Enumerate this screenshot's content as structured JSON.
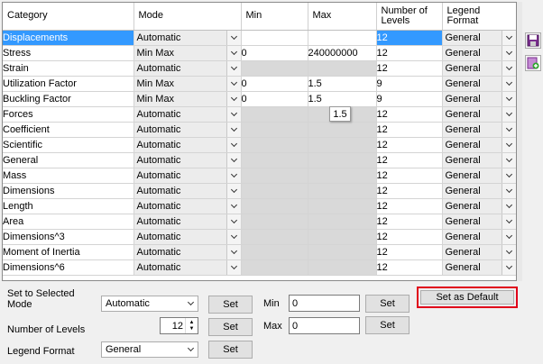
{
  "grid": {
    "headers": {
      "category": "Category",
      "mode": "Mode",
      "min": "Min",
      "max": "Max",
      "levels": "Number of Levels",
      "legend": "Legend Format"
    },
    "rows": [
      {
        "category": "Displacements",
        "mode": "Automatic",
        "min": "",
        "max": "",
        "levels": "12",
        "legend": "General"
      },
      {
        "category": "Stress",
        "mode": "Min Max",
        "min": "0",
        "max": "240000000",
        "levels": "12",
        "legend": "General"
      },
      {
        "category": "Strain",
        "mode": "Automatic",
        "min": "",
        "max": "",
        "levels": "12",
        "legend": "General"
      },
      {
        "category": "Utilization Factor",
        "mode": "Min Max",
        "min": "0",
        "max": "1.5",
        "levels": "9",
        "legend": "General"
      },
      {
        "category": "Buckling Factor",
        "mode": "Min Max",
        "min": "0",
        "max": "1.5",
        "levels": "9",
        "legend": "General"
      },
      {
        "category": "Forces",
        "mode": "Automatic",
        "min": "",
        "max": "",
        "levels": "12",
        "legend": "General"
      },
      {
        "category": "Coefficient",
        "mode": "Automatic",
        "min": "",
        "max": "",
        "levels": "12",
        "legend": "General"
      },
      {
        "category": "Scientific",
        "mode": "Automatic",
        "min": "",
        "max": "",
        "levels": "12",
        "legend": "General"
      },
      {
        "category": "General",
        "mode": "Automatic",
        "min": "",
        "max": "",
        "levels": "12",
        "legend": "General"
      },
      {
        "category": "Mass",
        "mode": "Automatic",
        "min": "",
        "max": "",
        "levels": "12",
        "legend": "General"
      },
      {
        "category": "Dimensions",
        "mode": "Automatic",
        "min": "",
        "max": "",
        "levels": "12",
        "legend": "General"
      },
      {
        "category": "Length",
        "mode": "Automatic",
        "min": "",
        "max": "",
        "levels": "12",
        "legend": "General"
      },
      {
        "category": "Area",
        "mode": "Automatic",
        "min": "",
        "max": "",
        "levels": "12",
        "legend": "General"
      },
      {
        "category": "Dimensions^3",
        "mode": "Automatic",
        "min": "",
        "max": "",
        "levels": "12",
        "legend": "General"
      },
      {
        "category": "Moment of Inertia",
        "mode": "Automatic",
        "min": "",
        "max": "",
        "levels": "12",
        "legend": "General"
      },
      {
        "category": "Dimensions^6",
        "mode": "Automatic",
        "min": "",
        "max": "",
        "levels": "12",
        "legend": "General"
      }
    ],
    "tooltip": "1.5"
  },
  "side": {
    "save_icon": "save-icon",
    "add_icon": "add-icon"
  },
  "set_selected": {
    "title": "Set to Selected",
    "mode_label": "Mode",
    "mode_value": "Automatic",
    "levels_label": "Number of Levels",
    "levels_value": "12",
    "legend_label": "Legend Format",
    "legend_value": "General",
    "min_label": "Min",
    "min_value": "0",
    "max_label": "Max",
    "max_value": "0",
    "set_label": "Set"
  },
  "default_button": "Set as Default",
  "colors": {
    "selection": "#3399ff",
    "highlight_border": "#e0001a"
  }
}
